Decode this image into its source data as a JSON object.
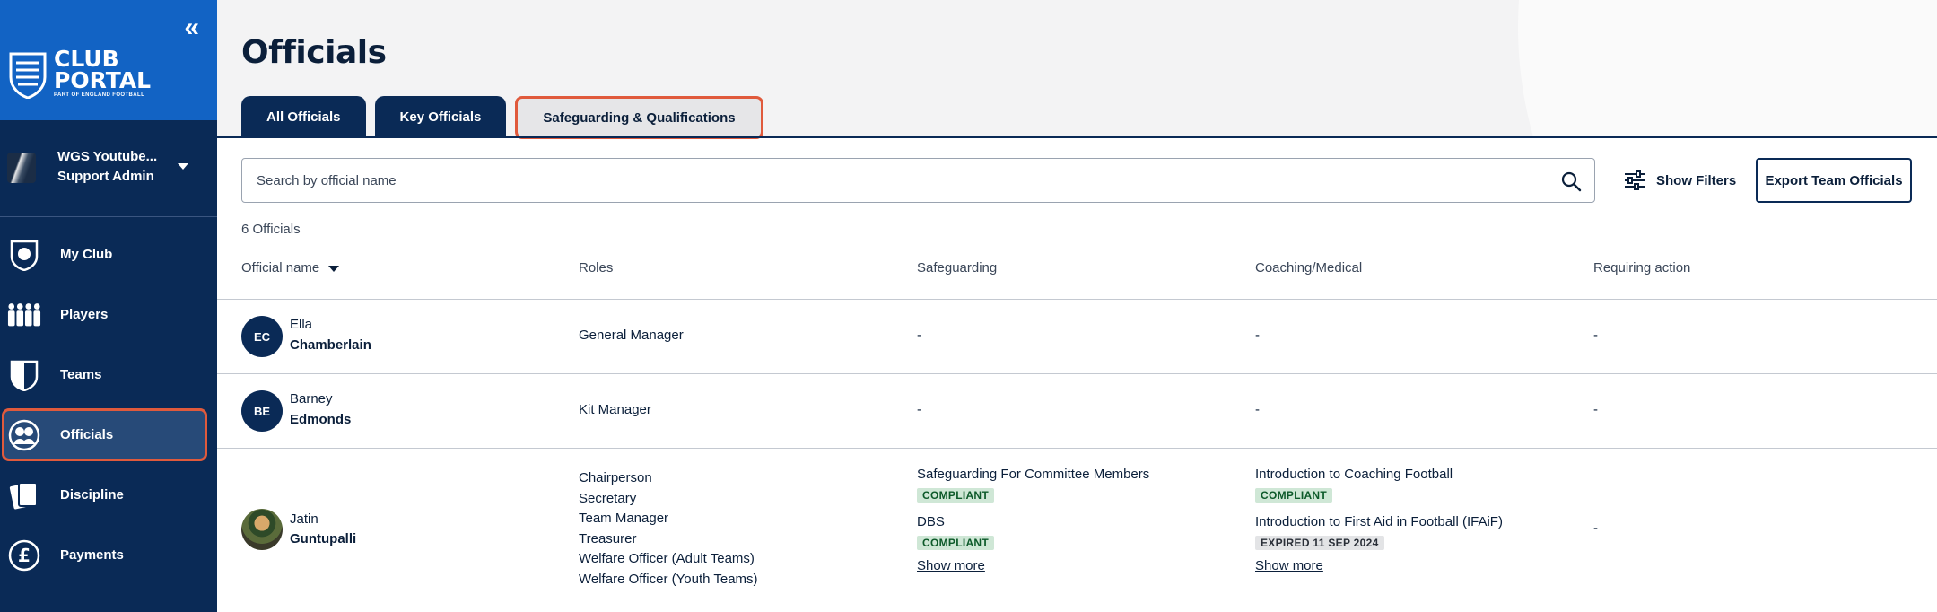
{
  "sidebar": {
    "collapse_glyph": "«",
    "brand": {
      "line1": "CLUB",
      "line2": "PORTAL",
      "sub": "PART OF ENGLAND FOOTBALL"
    },
    "account": {
      "name": "WGS Youtube...",
      "role": "Support Admin"
    },
    "items": [
      {
        "label": "My Club",
        "icon": "club-crest-icon"
      },
      {
        "label": "Players",
        "icon": "players-icon"
      },
      {
        "label": "Teams",
        "icon": "teams-shield-icon"
      },
      {
        "label": "Officials",
        "icon": "officials-icon",
        "active": true
      },
      {
        "label": "Discipline",
        "icon": "discipline-cards-icon"
      },
      {
        "label": "Payments",
        "icon": "pound-icon"
      }
    ]
  },
  "page": {
    "title": "Officials"
  },
  "tabs": [
    {
      "label": "All Officials"
    },
    {
      "label": "Key Officials"
    },
    {
      "label": "Safeguarding & Qualifications",
      "active": true
    }
  ],
  "search": {
    "placeholder": "Search by official name",
    "value": ""
  },
  "filters": {
    "label": "Show Filters"
  },
  "export": {
    "label": "Export Team Officials"
  },
  "count_text": "6 Officials",
  "table": {
    "headers": [
      "Official name",
      "Roles",
      "Safeguarding",
      "Coaching/Medical",
      "Requiring action"
    ],
    "rows": [
      {
        "initials": "EC",
        "first": "Ella",
        "last": "Chamberlain",
        "roles": [
          "General Manager"
        ],
        "safeguarding": "-",
        "coaching": "-",
        "action": "-"
      },
      {
        "initials": "BE",
        "first": "Barney",
        "last": "Edmonds",
        "roles": [
          "Kit Manager"
        ],
        "safeguarding": "-",
        "coaching": "-",
        "action": "-"
      },
      {
        "initials": "",
        "first": "Jatin",
        "last": "Guntupalli",
        "roles": [
          "Chairperson",
          "Secretary",
          "Team Manager",
          "Treasurer",
          "Welfare Officer (Adult Teams)",
          "Welfare Officer (Youth Teams)"
        ],
        "safeguarding_items": [
          {
            "name": "Safeguarding For Committee Members",
            "status": "COMPLIANT"
          },
          {
            "name": "DBS",
            "status": "COMPLIANT"
          }
        ],
        "coaching_items": [
          {
            "name": "Introduction to Coaching Football",
            "status": "COMPLIANT"
          },
          {
            "name": "Introduction to First Aid in Football (IFAiF)",
            "status": "EXPIRED 11 SEP 2024"
          }
        ],
        "show_more": "Show more",
        "action": "-"
      }
    ]
  },
  "colors": {
    "sidebar": "#0a2a56",
    "brand": "#1263c4",
    "highlight": "#e05a3c",
    "compliant_bg": "#cfe7d6"
  }
}
